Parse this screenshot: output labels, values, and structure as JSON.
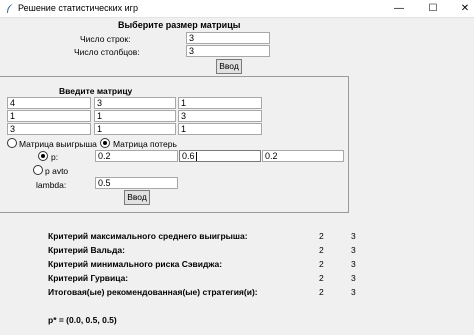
{
  "window": {
    "title": "Решение статистических игр",
    "minimize_glyph": "—",
    "maximize_glyph": "☐",
    "close_glyph": "✕"
  },
  "size_section": {
    "heading": "Выберите размер матрицы",
    "rows_label": "Число строк:",
    "rows_value": "3",
    "cols_label": "Число столбцов:",
    "cols_value": "3",
    "submit_label": "Ввод"
  },
  "matrix_section": {
    "heading": "Введите матрицу",
    "cells": [
      [
        "4",
        "3",
        "1"
      ],
      [
        "1",
        "1",
        "3"
      ],
      [
        "3",
        "1",
        "1"
      ]
    ],
    "radio_gain_label": "Матрица выигрыша",
    "radio_loss_label": "Матрица потерь",
    "radio_loss_selected": true,
    "p_label": "p:",
    "p_values": [
      "0.2",
      "0.6",
      "0.2"
    ],
    "p_auto_label": "p avto",
    "lambda_label": "lambda:",
    "lambda_value": "0.5",
    "submit_label": "Ввод"
  },
  "results": [
    {
      "label": "Критерий максимального среднего выигрыша:",
      "values": [
        "2",
        "3"
      ]
    },
    {
      "label": "Критерий Вальда:",
      "values": [
        "2",
        "3"
      ]
    },
    {
      "label": "Критерий минимального риска Сэвиджа:",
      "values": [
        "2",
        "3"
      ]
    },
    {
      "label": "Критерий Гурвица:",
      "values": [
        "2",
        "3"
      ]
    },
    {
      "label": "Итоговая(ые) рекомендованная(ые) стратегия(и):",
      "values": [
        "2",
        "3"
      ]
    }
  ],
  "p_star": "p* = (0.0, 0.5, 0.5)"
}
